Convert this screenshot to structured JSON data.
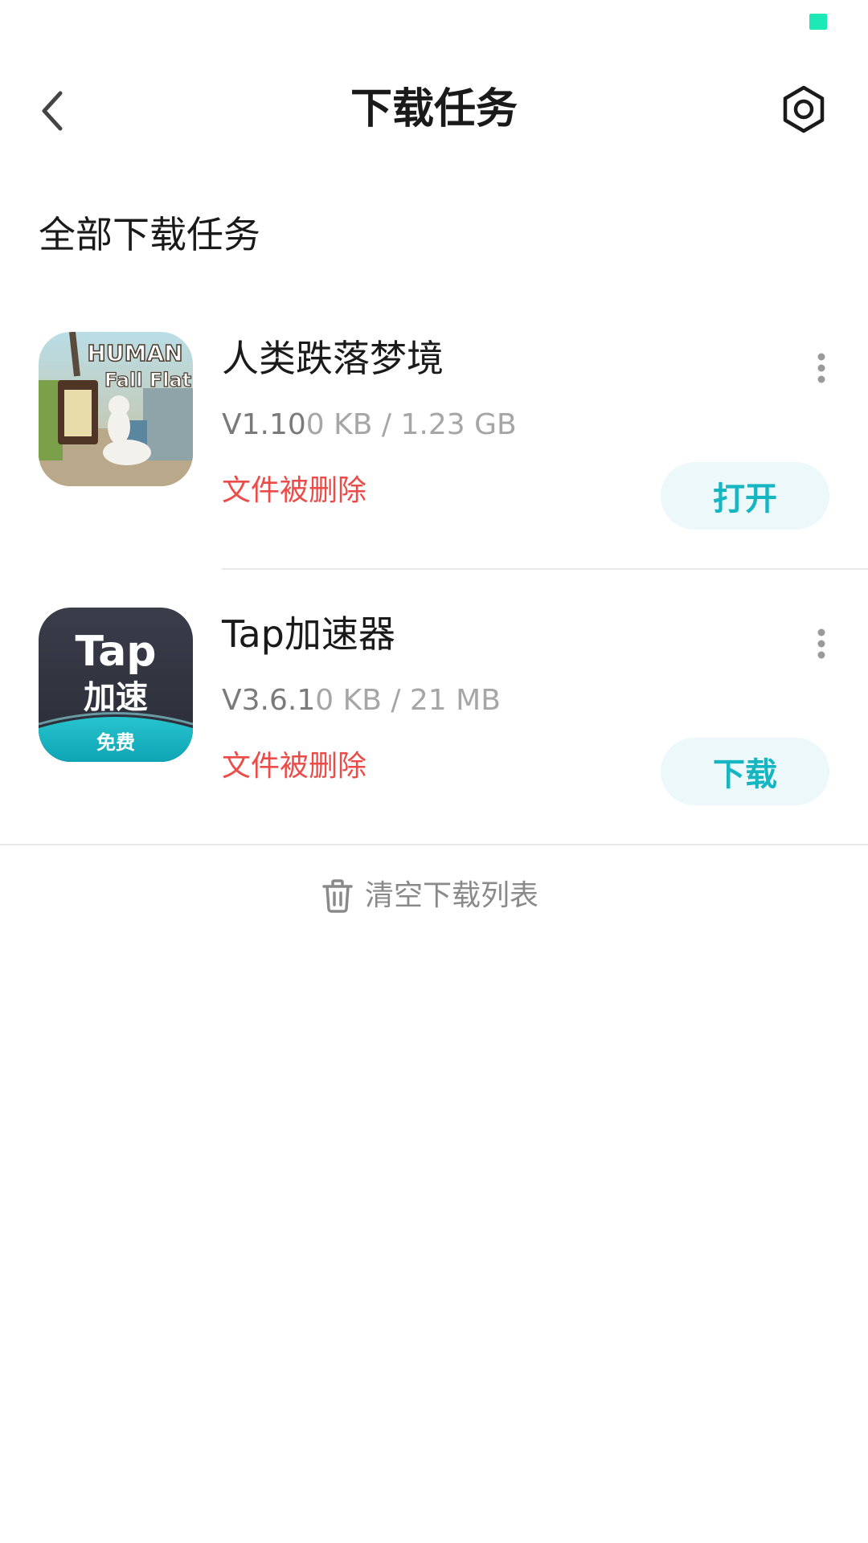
{
  "colors": {
    "accent": "#15b5c2",
    "accent_bg": "#ecf8f9",
    "error": "#ec4b48",
    "status_battery": "#1de9b6"
  },
  "header": {
    "back_icon": "chevron-left-icon",
    "title": "下载任务",
    "settings_icon": "hexagon-settings-icon"
  },
  "section": {
    "title": "全部下载任务"
  },
  "tasks": [
    {
      "name": "人类跌落梦境",
      "version_label": "V1.10",
      "size_label": "0 KB / 1.23 GB",
      "status": "文件被删除",
      "action_label": "打开",
      "icon_text": {
        "line1": "HUMAN",
        "line2": "Fall Flat"
      }
    },
    {
      "name": "Tap加速器",
      "version_label": "V3.6.1",
      "size_label": "0 KB / 21 MB",
      "status": "文件被删除",
      "action_label": "下载",
      "icon_text": {
        "line1": "Tap",
        "line2": "加速",
        "badge": "免费"
      }
    }
  ],
  "footer": {
    "clear_icon": "trash-icon",
    "clear_label": "清空下载列表"
  }
}
